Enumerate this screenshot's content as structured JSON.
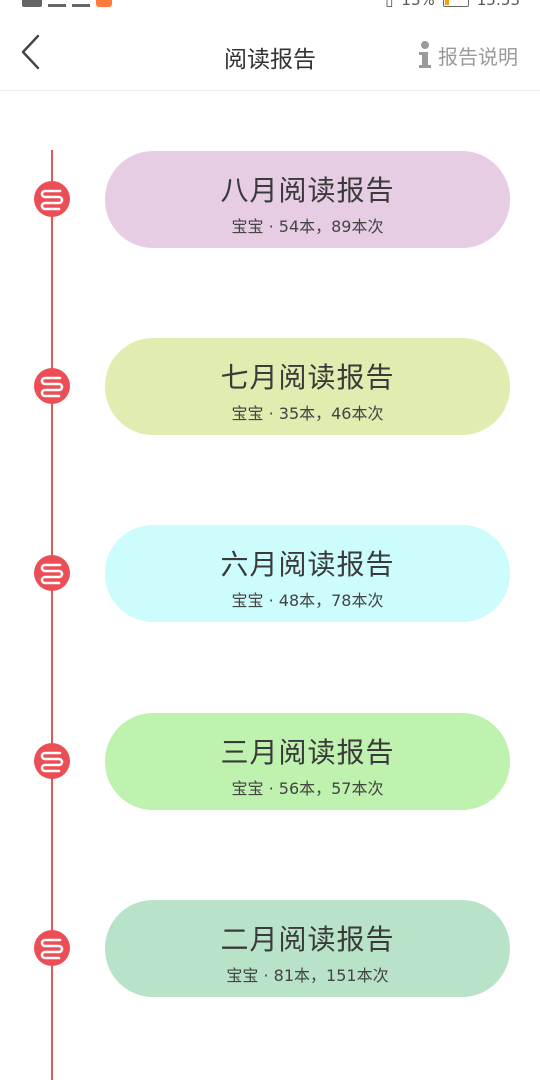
{
  "status_bar": {
    "battery": "13%",
    "time": "15:53"
  },
  "header": {
    "title": "阅读报告",
    "help_label": "报告说明",
    "back_icon": "chevron-left-icon",
    "help_icon": "info-icon"
  },
  "colors": {
    "timeline": "#e05a5a",
    "node": "#ec4e55"
  },
  "reports": [
    {
      "title": "八月阅读报告",
      "subtitle": "宝宝 · 54本，89本次",
      "color": "#e6cde3"
    },
    {
      "title": "七月阅读报告",
      "subtitle": "宝宝 · 35本，46本次",
      "color": "#e0ecb0"
    },
    {
      "title": "六月阅读报告",
      "subtitle": "宝宝 · 48本，78本次",
      "color": "#ccfcfc"
    },
    {
      "title": "三月阅读报告",
      "subtitle": "宝宝 · 56本，57本次",
      "color": "#bef2ae"
    },
    {
      "title": "二月阅读报告",
      "subtitle": "宝宝 · 81本，151本次",
      "color": "#b9e3c9"
    }
  ]
}
